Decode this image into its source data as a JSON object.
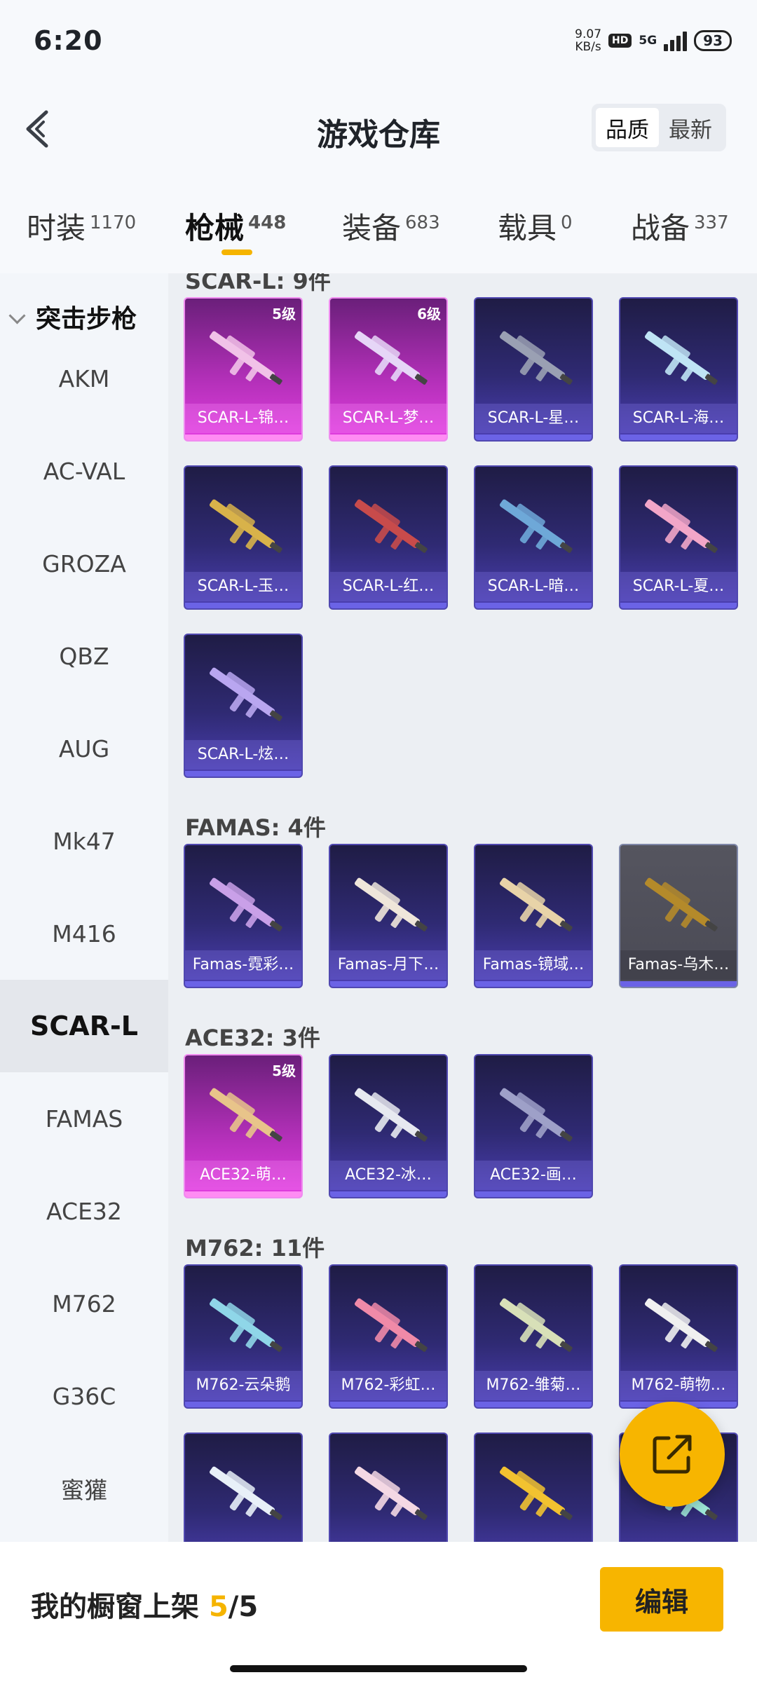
{
  "status_bar": {
    "time": "6:20",
    "speed_value": "9.07",
    "speed_unit": "KB/s",
    "hd": "HD",
    "network": "5G",
    "battery": "93"
  },
  "header": {
    "title": "游戏仓库",
    "sort_options": [
      "品质",
      "最新"
    ],
    "sort_selected": "品质"
  },
  "tabs": [
    {
      "label": "时装",
      "count": "1170"
    },
    {
      "label": "枪械",
      "count": "448",
      "active": true
    },
    {
      "label": "装备",
      "count": "683"
    },
    {
      "label": "载具",
      "count": "0"
    },
    {
      "label": "战备",
      "count": "337"
    }
  ],
  "sidebar": {
    "group": "突击步枪",
    "items": [
      "AKM",
      "AC-VAL",
      "GROZA",
      "QBZ",
      "AUG",
      "Mk47",
      "M416",
      "SCAR-L",
      "FAMAS",
      "ACE32",
      "M762",
      "G36C",
      "蜜獾"
    ],
    "selected": "SCAR-L"
  },
  "sections": [
    {
      "title": "SCAR-L: 9件",
      "items": [
        {
          "name": "SCAR-L-锦…",
          "level": "5级",
          "rarity": "pink"
        },
        {
          "name": "SCAR-L-梦…",
          "level": "6级",
          "rarity": "pink"
        },
        {
          "name": "SCAR-L-星…",
          "rarity": "normal"
        },
        {
          "name": "SCAR-L-海…",
          "rarity": "normal"
        },
        {
          "name": "SCAR-L-玉…",
          "rarity": "normal"
        },
        {
          "name": "SCAR-L-红…",
          "rarity": "normal"
        },
        {
          "name": "SCAR-L-暗…",
          "rarity": "normal"
        },
        {
          "name": "SCAR-L-夏…",
          "rarity": "normal"
        },
        {
          "name": "SCAR-L-炫…",
          "rarity": "normal"
        }
      ]
    },
    {
      "title": "FAMAS: 4件",
      "items": [
        {
          "name": "Famas-霓彩…",
          "rarity": "normal"
        },
        {
          "name": "Famas-月下…",
          "rarity": "normal"
        },
        {
          "name": "Famas-镜域…",
          "rarity": "normal"
        },
        {
          "name": "Famas-乌木…",
          "rarity": "gray"
        }
      ]
    },
    {
      "title": "ACE32: 3件",
      "items": [
        {
          "name": "ACE32-萌…",
          "level": "5级",
          "rarity": "pink"
        },
        {
          "name": "ACE32-冰…",
          "rarity": "normal"
        },
        {
          "name": "ACE32-画…",
          "rarity": "normal"
        }
      ]
    },
    {
      "title": "M762: 11件",
      "items": [
        {
          "name": "M762-云朵鹅",
          "rarity": "normal"
        },
        {
          "name": "M762-彩虹…",
          "rarity": "normal"
        },
        {
          "name": "M762-雏菊…",
          "rarity": "normal"
        },
        {
          "name": "M762-萌物…",
          "rarity": "normal"
        },
        {
          "name": "",
          "rarity": "normal"
        },
        {
          "name": "",
          "rarity": "normal"
        },
        {
          "name": "",
          "rarity": "normal"
        },
        {
          "name": "",
          "rarity": "normal"
        }
      ]
    }
  ],
  "bottom": {
    "shelf_label": "我的橱窗上架",
    "shelf_current": "5",
    "shelf_sep": "/",
    "shelf_total": "5",
    "edit_label": "编辑"
  },
  "colors": {
    "accent": "#f7b500",
    "card_normal": "#2f2a73",
    "card_pink": "#b02fb6"
  },
  "icons": [
    "back-arrow-icon",
    "share-out-icon",
    "chevron-down-icon"
  ]
}
